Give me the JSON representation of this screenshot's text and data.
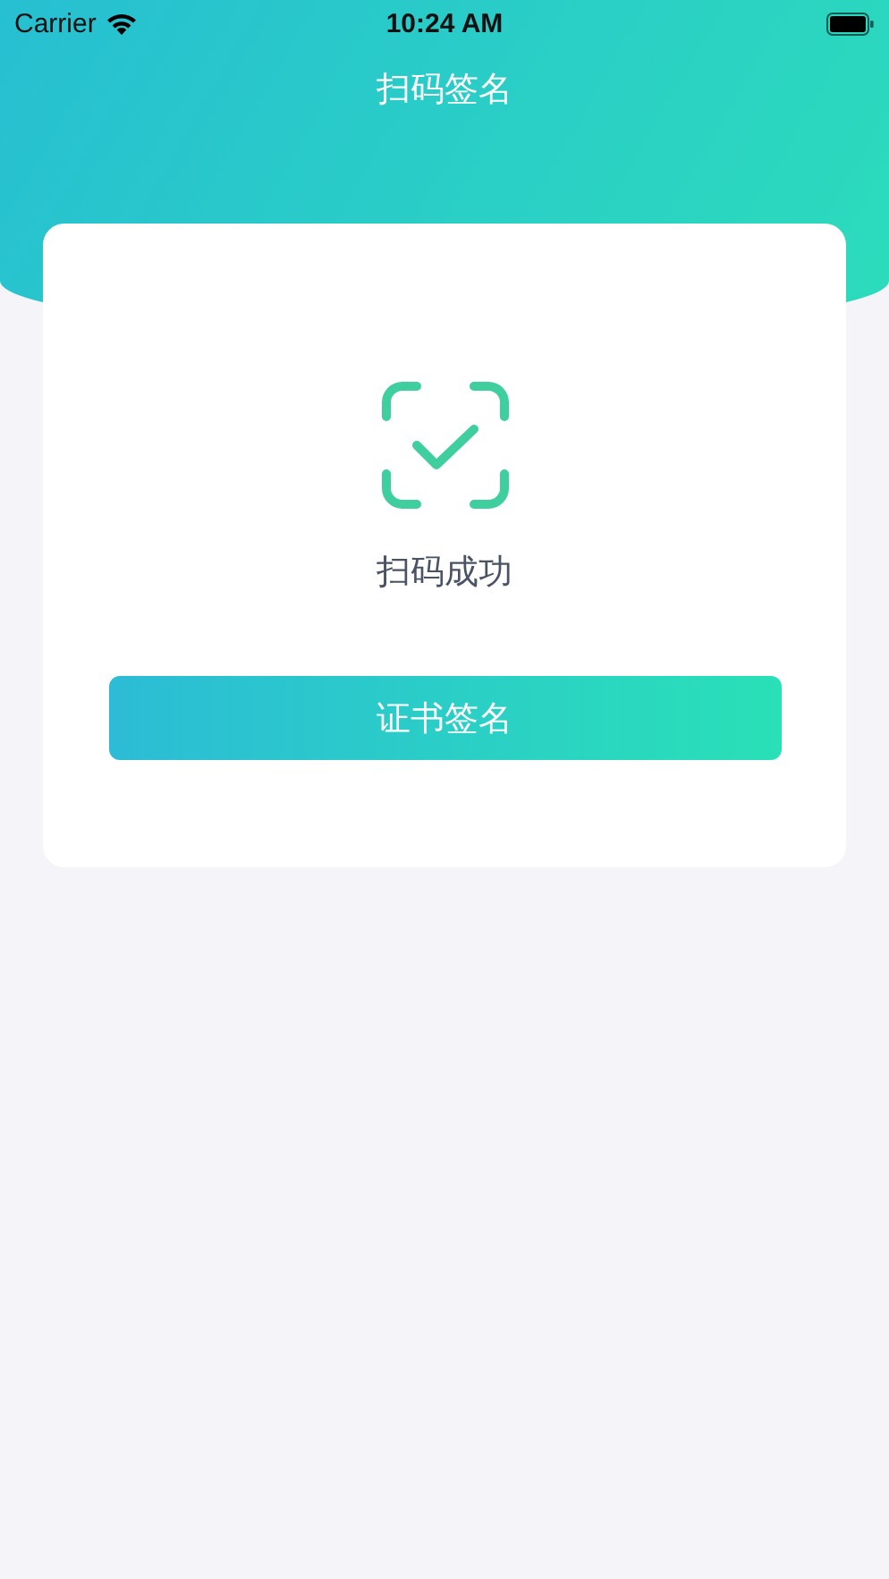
{
  "status_bar": {
    "carrier": "Carrier",
    "time": "10:24 AM"
  },
  "nav": {
    "title": "扫码签名"
  },
  "result": {
    "message": "扫码成功"
  },
  "button": {
    "label": "证书签名"
  }
}
